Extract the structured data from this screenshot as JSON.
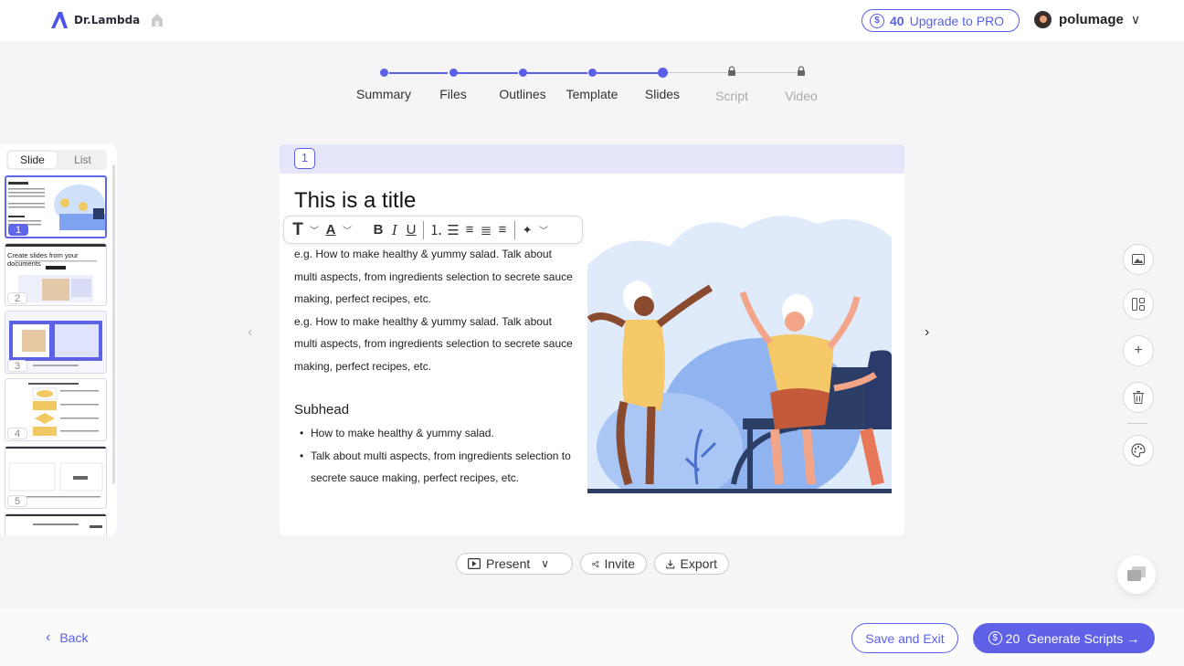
{
  "header": {
    "brand": "Dr.Lambda",
    "credits": "40",
    "upgrade_label": "Upgrade to PRO",
    "username": "polumage"
  },
  "stepper": {
    "steps": [
      {
        "label": "Summary",
        "state": "done"
      },
      {
        "label": "Files",
        "state": "done"
      },
      {
        "label": "Outlines",
        "state": "done"
      },
      {
        "label": "Template",
        "state": "done"
      },
      {
        "label": "Slides",
        "state": "active"
      },
      {
        "label": "Script",
        "state": "locked"
      },
      {
        "label": "Video",
        "state": "locked"
      }
    ]
  },
  "thumbnails": {
    "tabs": [
      "Slide",
      "List"
    ],
    "active_tab": "Slide",
    "items": [
      {
        "num": "1",
        "active": true
      },
      {
        "num": "2",
        "active": false,
        "title": "Create slides from your documents"
      },
      {
        "num": "3",
        "active": false
      },
      {
        "num": "4",
        "active": false
      },
      {
        "num": "5",
        "active": false
      }
    ]
  },
  "slide": {
    "number": "1",
    "title": "This is a title",
    "paragraphs": [
      "e.g. How to make healthy & yummy salad. Talk about multi aspects, from ingredients selection to secrete sauce making, perfect recipes, etc.",
      "e.g. How to make healthy & yummy salad. Talk about multi aspects, from ingredients selection to secrete sauce making, perfect recipes, etc."
    ],
    "subhead": "Subhead",
    "bullets": [
      "How to make healthy & yummy salad.",
      "Talk about multi aspects, from ingredients selection to secrete sauce making, perfect recipes, etc."
    ]
  },
  "actions": {
    "present": "Present",
    "invite": "Invite",
    "export": "Export"
  },
  "footer": {
    "back": "Back",
    "save_exit": "Save and Exit",
    "generate_cost": "20",
    "generate_label": "Generate Scripts"
  },
  "colors": {
    "accent": "#5a5fe8",
    "slide_header": "#e6e6fb"
  }
}
